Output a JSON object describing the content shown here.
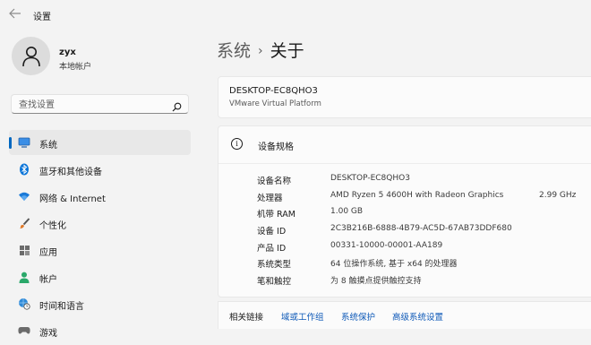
{
  "window": {
    "title": "设置"
  },
  "user": {
    "name": "zyx",
    "account_type": "本地帐户"
  },
  "search": {
    "placeholder": "查找设置"
  },
  "sidebar": {
    "items": [
      {
        "label": "系统",
        "icon": "monitor-icon",
        "active": true
      },
      {
        "label": "蓝牙和其他设备",
        "icon": "bluetooth-icon"
      },
      {
        "label": "网络 & Internet",
        "icon": "wifi-icon"
      },
      {
        "label": "个性化",
        "icon": "brush-icon"
      },
      {
        "label": "应用",
        "icon": "apps-icon"
      },
      {
        "label": "帐户",
        "icon": "account-icon"
      },
      {
        "label": "时间和语言",
        "icon": "globe-clock-icon"
      },
      {
        "label": "游戏",
        "icon": "gaming-icon"
      }
    ]
  },
  "breadcrumb": {
    "parent": "系统",
    "separator": "›",
    "current": "关于"
  },
  "device": {
    "name": "DESKTOP-EC8QHO3",
    "model": "VMware Virtual Platform"
  },
  "specs": {
    "title": "设备规格",
    "rows": [
      {
        "key": "设备名称",
        "value": "DESKTOP-EC8QHO3",
        "extra": ""
      },
      {
        "key": "处理器",
        "value": "AMD Ryzen 5 4600H with Radeon Graphics",
        "extra": "2.99 GHz"
      },
      {
        "key": "机带 RAM",
        "value": "1.00 GB",
        "extra": ""
      },
      {
        "key": "设备 ID",
        "value": "2C3B216B-6888-4B79-AC5D-67AB73DDF680",
        "extra": ""
      },
      {
        "key": "产品 ID",
        "value": "00331-10000-00001-AA189",
        "extra": ""
      },
      {
        "key": "系统类型",
        "value": "64 位操作系统, 基于 x64 的处理器",
        "extra": ""
      },
      {
        "key": "笔和触控",
        "value": "为 8 触摸点提供触控支持",
        "extra": ""
      }
    ]
  },
  "related": {
    "label": "相关链接",
    "links": [
      "域或工作组",
      "系统保护",
      "高级系统设置"
    ]
  },
  "colors": {
    "accent": "#0067c0",
    "link": "#0f5ab8",
    "background": "#f3f3f3",
    "card": "#fbfbfb"
  }
}
